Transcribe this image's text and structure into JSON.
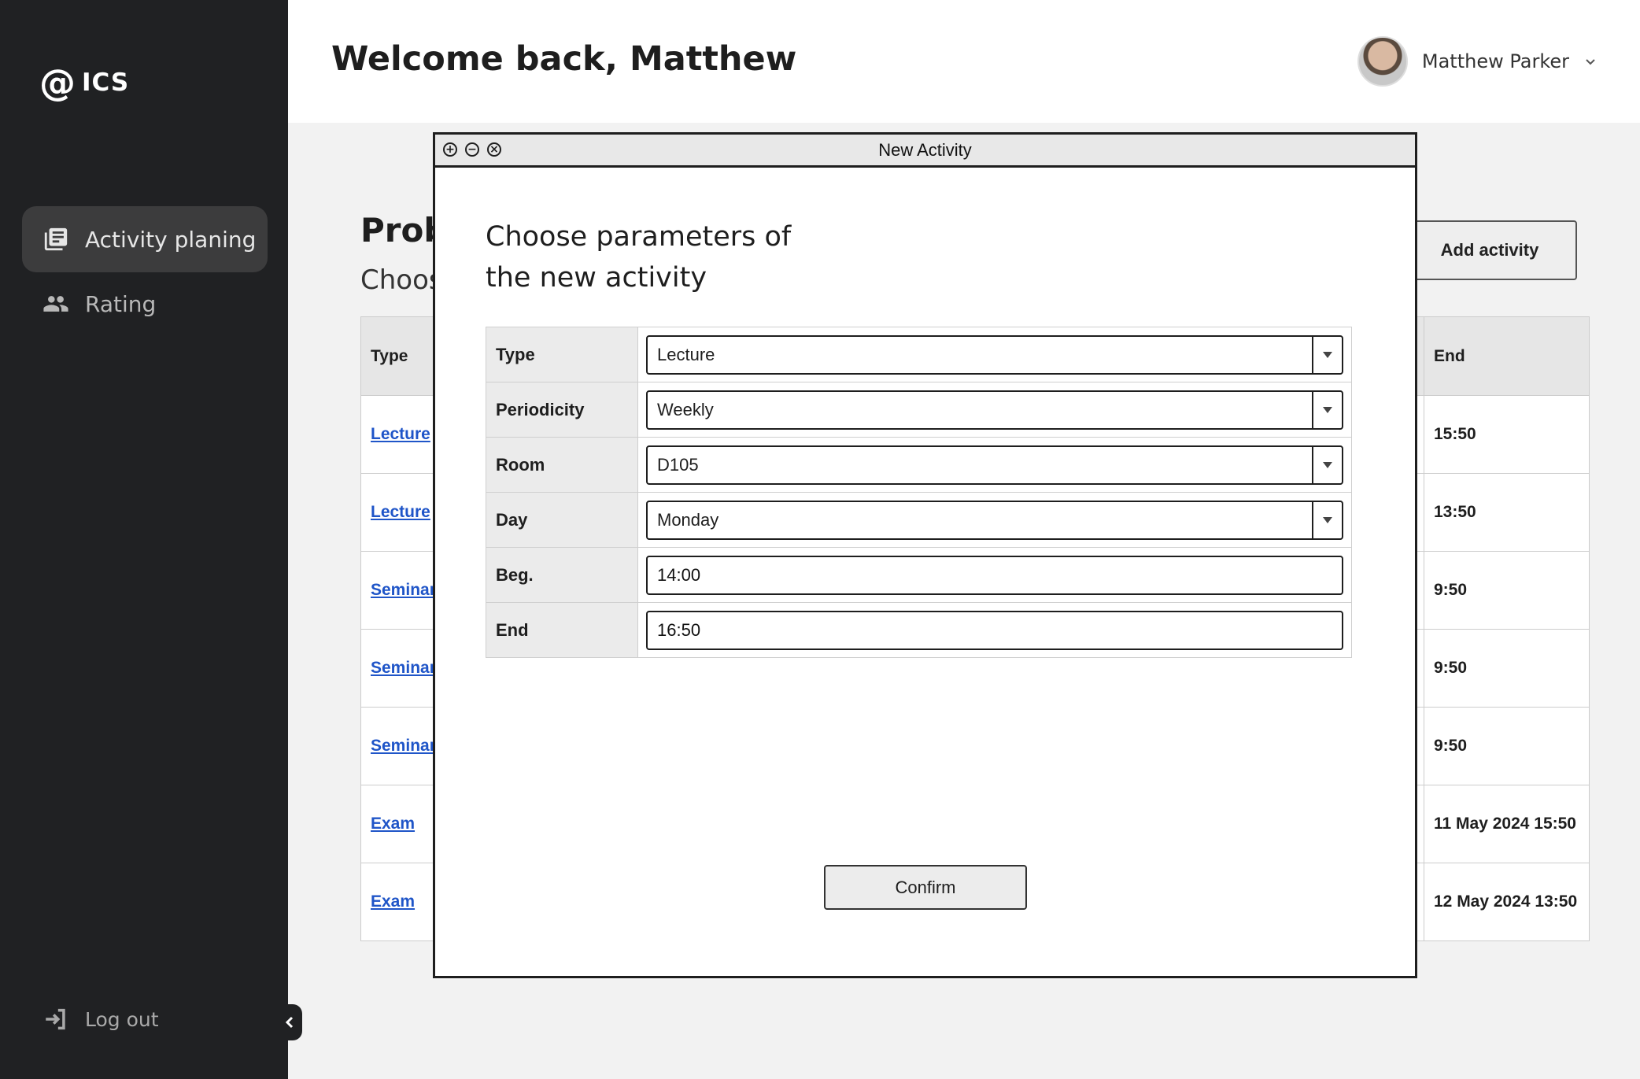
{
  "sidebar": {
    "logo": {
      "symbol": "@",
      "name": "ICS"
    },
    "items": [
      {
        "label": "Activity planing",
        "icon": "library-books-icon",
        "active": true
      },
      {
        "label": "Rating",
        "icon": "people-icon",
        "active": false
      }
    ],
    "logout_label": "Log out"
  },
  "header": {
    "welcome": "Welcome back, Matthew",
    "user_name": "Matthew Parker"
  },
  "background": {
    "title_partial": "Prob",
    "subtitle_partial": "Choos",
    "add_button": "Add activity",
    "columns": {
      "type": "Type",
      "end": "End"
    },
    "rows": [
      {
        "type": "Lecture",
        "end": "15:50"
      },
      {
        "type": "Lecture",
        "end": "13:50"
      },
      {
        "type": "Seminar",
        "end": "9:50"
      },
      {
        "type": "Seminar",
        "end": "9:50"
      },
      {
        "type": "Seminar",
        "end": "9:50"
      },
      {
        "type": "Exam",
        "end": "11 May 2024 15:50"
      },
      {
        "type": "Exam",
        "end": "12 May 2024 13:50"
      }
    ]
  },
  "modal": {
    "title": "New Activity",
    "heading_line1": "Choose parameters of",
    "heading_line2": "the new activity",
    "fields": {
      "type": {
        "label": "Type",
        "value": "Lecture"
      },
      "periodicity": {
        "label": "Periodicity",
        "value": "Weekly"
      },
      "room": {
        "label": "Room",
        "value": "D105"
      },
      "day": {
        "label": "Day",
        "value": "Monday"
      },
      "beg": {
        "label": "Beg.",
        "value": "14:00"
      },
      "end": {
        "label": "End",
        "value": "16:50"
      }
    },
    "confirm": "Confirm"
  }
}
